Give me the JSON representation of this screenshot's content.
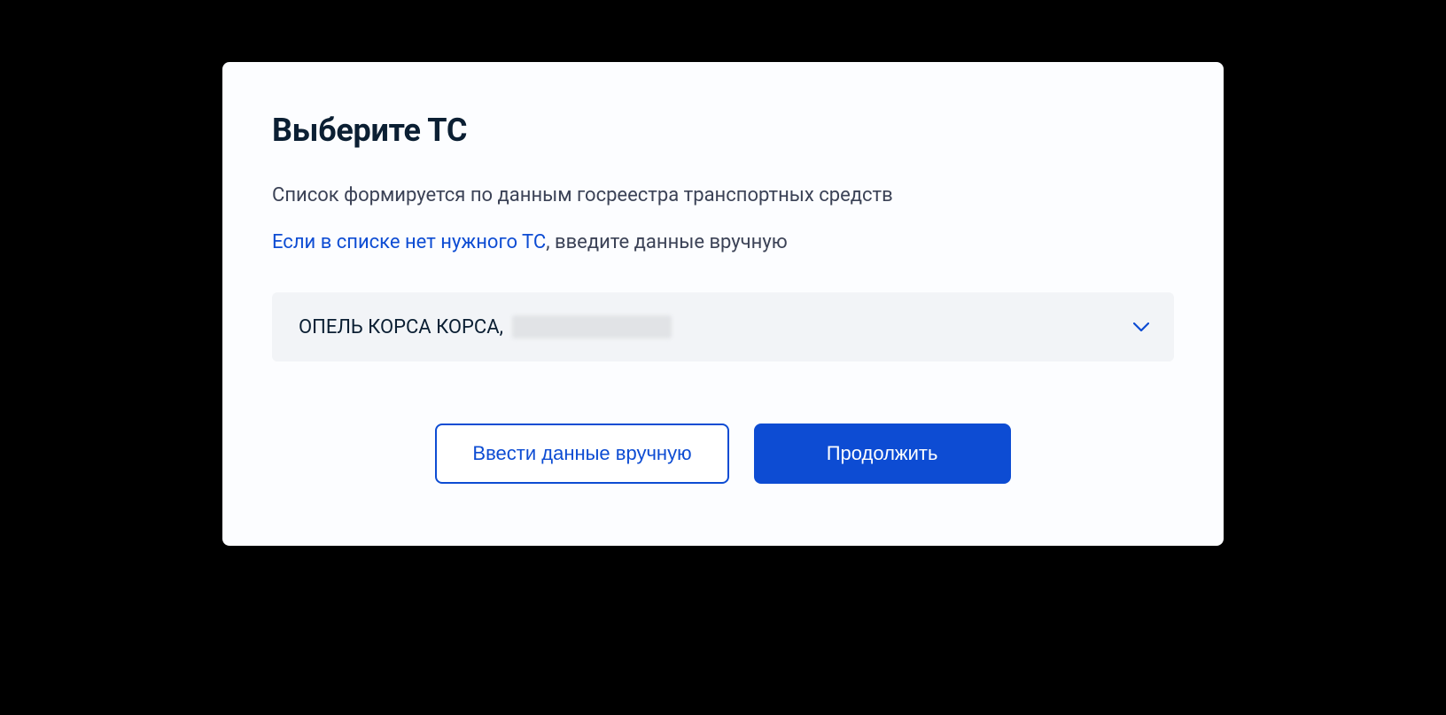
{
  "card": {
    "title": "Выберите ТС",
    "description": "Список формируется по данным госреестра транспортных средств",
    "hint_link": "Если в списке нет нужного ТС",
    "hint_rest": ", введите данные вручную",
    "select": {
      "value": "ОПЕЛЬ КОРСА КОРСА,"
    },
    "buttons": {
      "manual": "Ввести данные вручную",
      "continue": "Продолжить"
    }
  }
}
